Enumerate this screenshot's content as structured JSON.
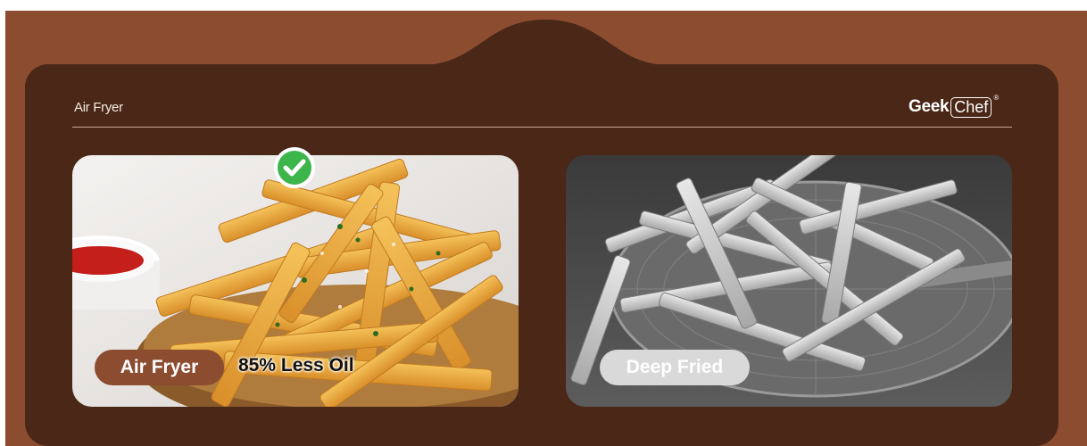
{
  "product_title": "Air Fryer",
  "brand": {
    "part_a": "Geek",
    "part_b": "Chef",
    "registered": "®"
  },
  "cards": [
    {
      "label": "Air Fryer",
      "claim": "85% Less Oil",
      "icon": "check-icon"
    },
    {
      "label": "Deep Fried"
    }
  ],
  "colors": {
    "outer_bg": "#8b4c30",
    "panel_bg": "#4a2716",
    "pill_air": "#8b4c30",
    "pill_deep": "#d9d9d9",
    "check_green": "#3cb54a"
  }
}
